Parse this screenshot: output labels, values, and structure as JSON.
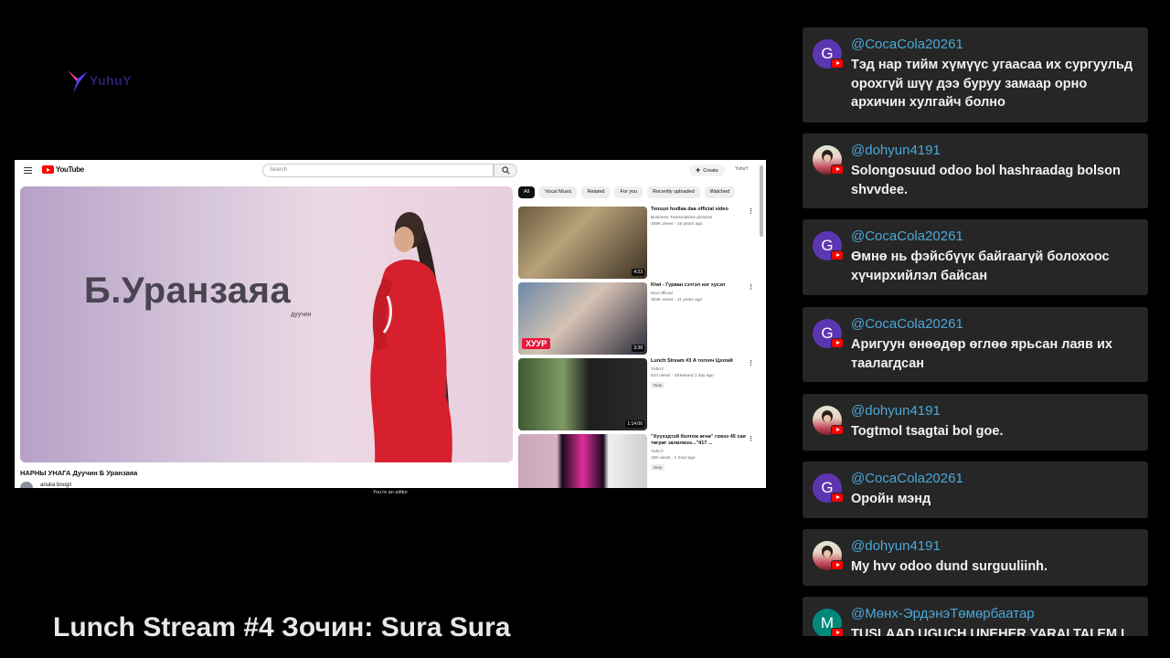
{
  "overlay": {
    "logo_text": "YuhuY",
    "stream_title": "Lunch Stream #4 Зочин: Sura Sura"
  },
  "browser": {
    "brand": "YouTube",
    "search_placeholder": "Search",
    "create_label": "Create",
    "account_label": "YuhuY",
    "player": {
      "art_title": "Б.Уранзаяа",
      "art_subtitle": "дуучин"
    },
    "video_title": "НАРНЫ УНАГА Дуучин Б Уранзаяа",
    "channel_name": "ariuka boogii",
    "editor_notice": "You're an editor",
    "chips": [
      "All",
      "Vocal Music",
      "Related",
      "For you",
      "Recently uploaded",
      "Watched"
    ],
    "recommendations": [
      {
        "title": "Tenuun hudlaa daa official video",
        "channel": "Business Transmission pictures",
        "meta": "459K views · 15 years ago",
        "duration": "4:23",
        "badge": ""
      },
      {
        "title": "Kiwi - Гурван сэтгэл нэг хусэл",
        "channel": "Kiwi official",
        "meta": "303K views · 11 years ago",
        "duration": "3:38",
        "badge": ""
      },
      {
        "title": "Lunch Stream #3 А тогооч Цэзгий",
        "channel": "YuhuY",
        "meta": "544 views · Streamed 1 day ago",
        "duration": "1:14:06",
        "badge": "New"
      },
      {
        "title": "\"Хүүхэдтэй болгож өгнө\" гэжээ 45 сая төгрөг залилжээ...\"417 ...",
        "channel": "YuhuY",
        "meta": "195 views · 1 hour ago",
        "duration": "",
        "badge": "New"
      }
    ],
    "thumb_brand": "ХУУР"
  },
  "chat": {
    "messages": [
      {
        "user": "@CocaCola20261",
        "avatar": "G",
        "avatar_type": "letter",
        "text": "Тэд нар тийм хүмүүс угаасаа их сургуульд орохгүй шүү дээ буруу замаар орно архичин хулгайч болно"
      },
      {
        "user": "@dohyun4191",
        "avatar": "",
        "avatar_type": "photo",
        "text": "Solongosuud odoo bol hashraadag bolson shvvdee."
      },
      {
        "user": "@CocaCola20261",
        "avatar": "G",
        "avatar_type": "letter",
        "text": "Өмнө нь фэйсбүүк байгаагүй болохоос хүчирхийлэл байсан"
      },
      {
        "user": "@CocaCola20261",
        "avatar": "G",
        "avatar_type": "letter",
        "text": "Аригуун өнөөдөр өглөө ярьсан лаяв их таалагдсан"
      },
      {
        "user": "@dohyun4191",
        "avatar": "",
        "avatar_type": "photo",
        "text": "Togtmol tsagtai bol goe."
      },
      {
        "user": "@CocaCola20261",
        "avatar": "G",
        "avatar_type": "letter",
        "text": "Оройн мэнд"
      },
      {
        "user": "@dohyun4191",
        "avatar": "",
        "avatar_type": "photo",
        "text": "My hvv odoo dund surguuliinh."
      },
      {
        "user": "@Мөнх-ЭрдэнэТөмөрбаатар",
        "avatar": "M",
        "avatar_type": "letter",
        "text": "TUSLAAD UGUCH UNEHER YARALTAI EM L"
      }
    ]
  },
  "colors": {
    "chat_card": "#262626",
    "username": "#4aa8d8",
    "avatar_purple": "#5e35b1",
    "avatar_teal": "#00897b"
  }
}
